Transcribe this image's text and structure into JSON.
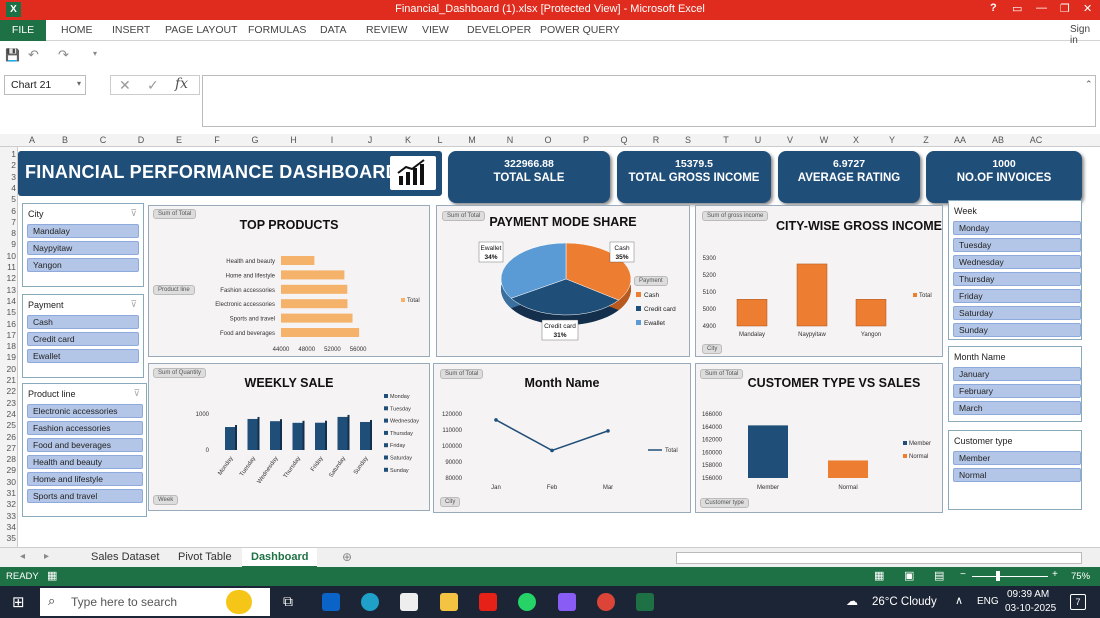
{
  "window": {
    "title": "Financial_Dashboard (1).xlsx  [Protected View] - Microsoft Excel",
    "logo": "X",
    "help": "?",
    "signin": "Sign in"
  },
  "ribbon": {
    "tabs": [
      "FILE",
      "HOME",
      "INSERT",
      "PAGE LAYOUT",
      "FORMULAS",
      "DATA",
      "REVIEW",
      "VIEW",
      "DEVELOPER",
      "POWER QUERY"
    ]
  },
  "formula_bar": {
    "name_box": "Chart 21",
    "fx": "fx",
    "value": ""
  },
  "grid": {
    "columns": [
      "A",
      "B",
      "C",
      "D",
      "E",
      "F",
      "G",
      "H",
      "I",
      "J",
      "K",
      "L",
      "M",
      "N",
      "O",
      "P",
      "Q",
      "R",
      "S",
      "T",
      "U",
      "V",
      "W",
      "X",
      "Y",
      "Z",
      "AA",
      "AB",
      "AC"
    ],
    "rows": [
      "1",
      "2",
      "3",
      "4",
      "5",
      "6",
      "7",
      "8",
      "9",
      "10",
      "11",
      "12",
      "13",
      "14",
      "15",
      "16",
      "17",
      "18",
      "19",
      "20",
      "21",
      "22",
      "23",
      "24",
      "25",
      "26",
      "27",
      "28",
      "29",
      "30",
      "31",
      "32",
      "33",
      "34",
      "35"
    ]
  },
  "dashboard": {
    "title": "FINANCIAL PERFORMANCE DASHBOARD",
    "kpis": [
      {
        "value": "322966.88",
        "label": "TOTAL SALE"
      },
      {
        "value": "15379.5",
        "label": "TOTAL GROSS INCOME"
      },
      {
        "value": "6.9727",
        "label": "AVERAGE RATING"
      },
      {
        "value": "1000",
        "label": "NO.OF INVOICES"
      }
    ]
  },
  "slicers": {
    "city": {
      "title": "City",
      "items": [
        "Mandalay",
        "Naypyitaw",
        "Yangon"
      ]
    },
    "payment": {
      "title": "Payment",
      "items": [
        "Cash",
        "Credit card",
        "Ewallet"
      ]
    },
    "product_line": {
      "title": "Product line",
      "items": [
        "Electronic accessories",
        "Fashion accessories",
        "Food and beverages",
        "Health and beauty",
        "Home and lifestyle",
        "Sports and travel"
      ]
    },
    "week": {
      "title": "Week",
      "items": [
        "Monday",
        "Tuesday",
        "Wednesday",
        "Thursday",
        "Friday",
        "Saturday",
        "Sunday"
      ]
    },
    "month": {
      "title": "Month Name",
      "items": [
        "January",
        "February",
        "March"
      ]
    },
    "customer": {
      "title": "Customer type",
      "items": [
        "Member",
        "Normal"
      ]
    }
  },
  "chart_data": [
    {
      "type": "bar",
      "title": "TOP PRODUCTS",
      "field_button": "Sum of Total",
      "axis_button": "Product line",
      "categories": [
        "Health and beauty",
        "Home and lifestyle",
        "Fashion accessories",
        "Electronic accessories",
        "Sports and travel",
        "Food and beverages"
      ],
      "values": [
        49193.7,
        53861.9,
        54305.9,
        54337.5,
        55122.8,
        56144.8
      ],
      "xlim": [
        44000,
        58000
      ],
      "xticks": [
        "44000",
        "48000",
        "52000",
        "56000"
      ],
      "legend": "Total",
      "color": "#f4b26a"
    },
    {
      "type": "pie",
      "title": "PAYMENT MODE SHARE",
      "field_button": "Sum of Total",
      "axis_button": "Payment",
      "labels": [
        "Cash",
        "Credit card",
        "Ewallet"
      ],
      "values": [
        35,
        31,
        34
      ],
      "data_labels": [
        "35%",
        "31%",
        "34%"
      ],
      "colors": [
        "#ed7d31",
        "#1f4e79",
        "#5b9bd5"
      ]
    },
    {
      "type": "bar",
      "title": "CITY-WISE GROSS INCOME",
      "field_button": "Sum of gross income",
      "axis_button": "City",
      "categories": [
        "Mandalay",
        "Naypyitaw",
        "Yangon"
      ],
      "values": [
        5057,
        5265,
        5057
      ],
      "ylim": [
        4900,
        5300
      ],
      "yticks": [
        "4900",
        "5000",
        "5100",
        "5200",
        "5300"
      ],
      "legend": "Total",
      "color": "#ed7d31"
    },
    {
      "type": "bar",
      "title": "WEEKLY SALE",
      "field_button": "Sum of Quantity",
      "axis_button": "Week",
      "categories": [
        "Monday",
        "Tuesday",
        "Wednesday",
        "Thursday",
        "Friday",
        "Saturday",
        "Sunday"
      ],
      "values": [
        638,
        862,
        800,
        755,
        758,
        919,
        778
      ],
      "ylim": [
        0,
        1000
      ],
      "yticks": [
        "0",
        "1000"
      ],
      "color": "#1f4e79"
    },
    {
      "type": "line",
      "title": "Month Name",
      "field_button": "Sum of Total",
      "axis_button": "City",
      "categories": [
        "Jan",
        "Feb",
        "Mar"
      ],
      "values": [
        116291,
        97219,
        109456
      ],
      "ylim": [
        80000,
        120000
      ],
      "yticks": [
        "80000",
        "90000",
        "100000",
        "110000",
        "120000"
      ],
      "legend": "Total",
      "color": "#1f4e79"
    },
    {
      "type": "bar",
      "title": "CUSTOMER TYPE VS SALES",
      "field_button": "Sum of Total",
      "axis_button": "Customer type",
      "categories": [
        "Member",
        "Normal"
      ],
      "values": [
        164223,
        158743
      ],
      "ylim": [
        156000,
        166000
      ],
      "yticks": [
        "156000",
        "158000",
        "160000",
        "162000",
        "164000",
        "166000"
      ],
      "series_colors": [
        "#1f4e79",
        "#ed7d31"
      ]
    }
  ],
  "sheet_tabs": [
    "Sales Dataset",
    "Pivot Table",
    "Dashboard"
  ],
  "status": {
    "mode": "READY",
    "zoom": "75%"
  },
  "taskbar": {
    "search": "Type here to search",
    "weather": "26°C  Cloudy",
    "lang": "ENG",
    "time": "09:39 AM",
    "date": "03-10-2025",
    "notifications": "7"
  }
}
